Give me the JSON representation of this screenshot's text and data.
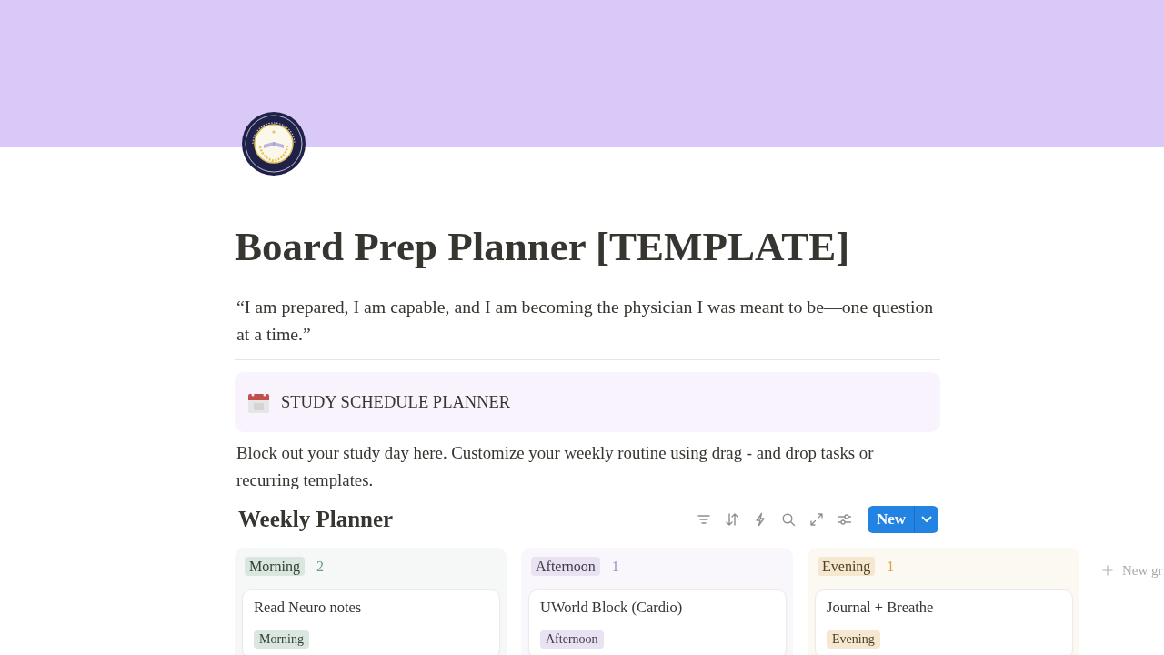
{
  "page": {
    "title": "Board Prep Planner [TEMPLATE]",
    "quote": "“I am prepared, I am capable, and I am becoming the physician I was meant to be—one question at a time.”",
    "callout": {
      "text": "STUDY SCHEDULE PLANNER"
    },
    "description": "Block out your study day here. Customize your weekly routine using drag - and drop tasks or recurring templates."
  },
  "board": {
    "title": "Weekly Planner",
    "new_button": {
      "label": "New"
    },
    "groups": [
      {
        "name": "Morning",
        "count": "2",
        "color": "#6a9e7f",
        "cards": [
          {
            "title": "Read Neuro notes",
            "tag": "Morning"
          }
        ]
      },
      {
        "name": "Afternoon",
        "count": "1",
        "color": "#a68bc9",
        "cards": [
          {
            "title": "UWorld Block (Cardio)",
            "tag": "Afternoon"
          }
        ]
      },
      {
        "name": "Evening",
        "count": "1",
        "color": "#d9a441",
        "cards": [
          {
            "title": "Journal + Breathe",
            "tag": "Evening"
          }
        ]
      }
    ],
    "new_group": "New gr"
  }
}
